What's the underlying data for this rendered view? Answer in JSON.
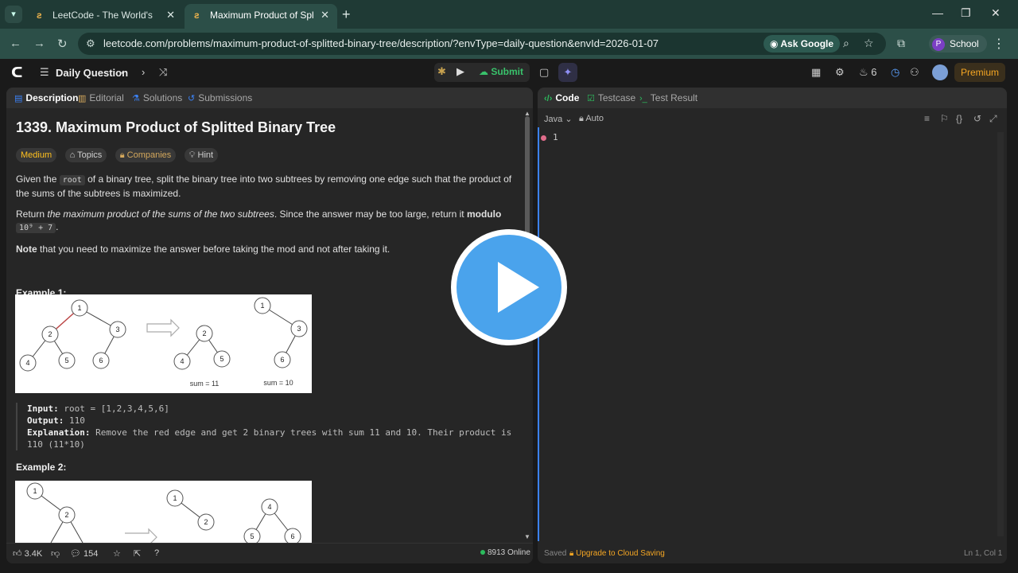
{
  "browser": {
    "tabs": [
      {
        "title": "LeetCode - The World's Leading",
        "active": false
      },
      {
        "title": "Maximum Product of Splitted B",
        "active": true
      }
    ],
    "url": "leetcode.com/problems/maximum-product-of-splitted-binary-tree/description/?envType=daily-question&envId=2026-01-07",
    "ask_google": "Ask Google",
    "profile_initial": "P",
    "profile_name": "School"
  },
  "lc": {
    "nav_title": "Daily Question",
    "submit_label": "Submit",
    "streak": "6",
    "premium_label": "Premium"
  },
  "left": {
    "tabs": {
      "description": "Description",
      "editorial": "Editorial",
      "solutions": "Solutions",
      "submissions": "Submissions"
    },
    "title": "1339. Maximum Product of Splitted Binary Tree",
    "badges": {
      "difficulty": "Medium",
      "topics": "Topics",
      "companies": "Companies",
      "hint": "Hint"
    },
    "p1": {
      "a": "Given the ",
      "code": "root",
      "b": " of a binary tree, split the binary tree into two subtrees by removing one edge such that the product of the sums of the subtrees is maximized."
    },
    "p2": {
      "a": "Return ",
      "em": "the maximum product of the sums of the two subtrees",
      "b": ". Since the answer may be too large, return it ",
      "strong": "modulo",
      "code": "10⁹ + 7",
      "c": "."
    },
    "p3": {
      "strong": "Note",
      "rest": " that you need to maximize the answer before taking the mod and not after taking it."
    },
    "example1": {
      "heading": "Example 1:",
      "sum_left": "sum = 11",
      "sum_right": "sum = 10",
      "input_label": "Input:",
      "input": "root = [1,2,3,4,5,6]",
      "output_label": "Output:",
      "output": "110",
      "explanation_label": "Explanation:",
      "explanation": "Remove the red edge and get 2 binary trees with sum 11 and 10. Their product is 110 (11*10)"
    },
    "example2": {
      "heading": "Example 2:"
    },
    "footer": {
      "likes": "3.4K",
      "comments": "154",
      "online": "8913 Online"
    }
  },
  "right": {
    "tabs": {
      "code": "Code",
      "testcase": "Testcase",
      "test_result": "Test Result"
    },
    "language": "Java",
    "mode": "Auto",
    "line_number": "1",
    "footer": {
      "saved": "Saved",
      "upgrade": "Upgrade to Cloud Saving",
      "cursor": "Ln 1, Col 1"
    }
  },
  "colors": {
    "accent_blue": "#4aa3ec",
    "submit_green": "#39c26b",
    "medium_yellow": "#ffc01e",
    "premium_orange": "#f5a623"
  }
}
